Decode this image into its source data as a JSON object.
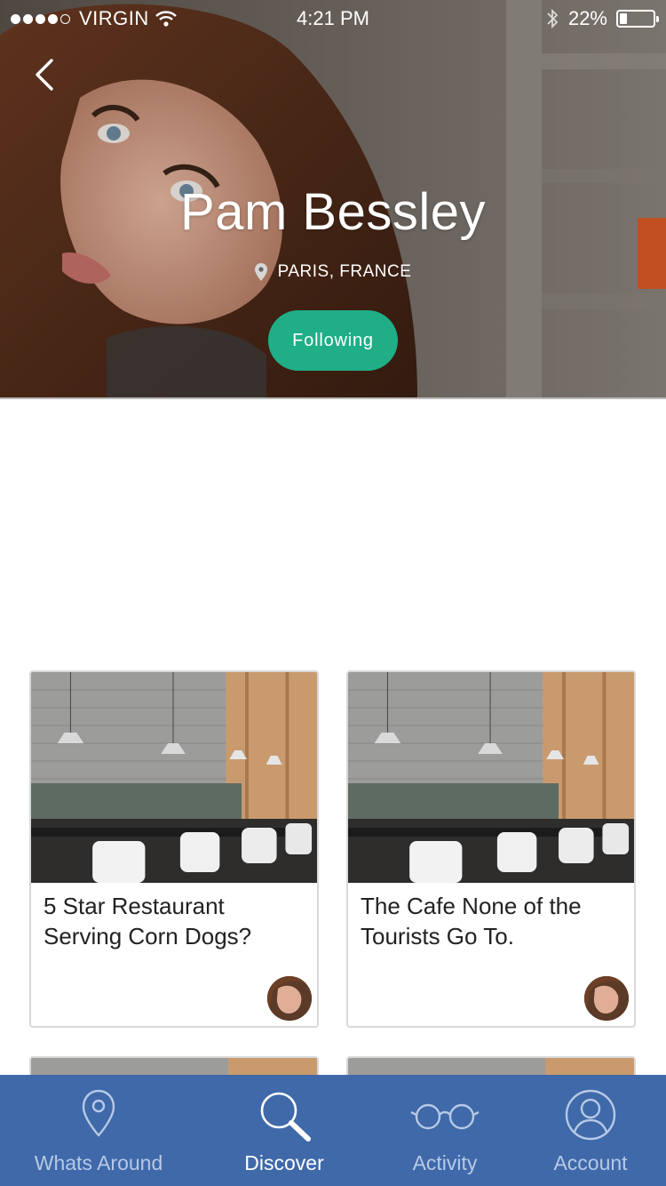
{
  "status_bar": {
    "carrier": "VIRGIN",
    "time": "4:21 PM",
    "battery": "22%",
    "battery_level": 0.22
  },
  "profile": {
    "name": "Pam Bessley",
    "location": "PARIS, FRANCE",
    "follow_label": "Following"
  },
  "cards": [
    {
      "title": "5 Star Restaurant Serving Corn Dogs?"
    },
    {
      "title": "The Cafe None of the Tourists Go To."
    }
  ],
  "tabs": [
    {
      "label": "Whats Around",
      "icon": "location-pin-icon",
      "active": false
    },
    {
      "label": "Discover",
      "icon": "search-icon",
      "active": true
    },
    {
      "label": "Activity",
      "icon": "glasses-icon",
      "active": false
    },
    {
      "label": "Account",
      "icon": "user-circle-icon",
      "active": false
    }
  ],
  "colors": {
    "accent_green": "#1fae86",
    "tab_bar": "#3f69a9",
    "tab_inactive": "#b7c9e6",
    "tab_active": "#ffffff"
  }
}
